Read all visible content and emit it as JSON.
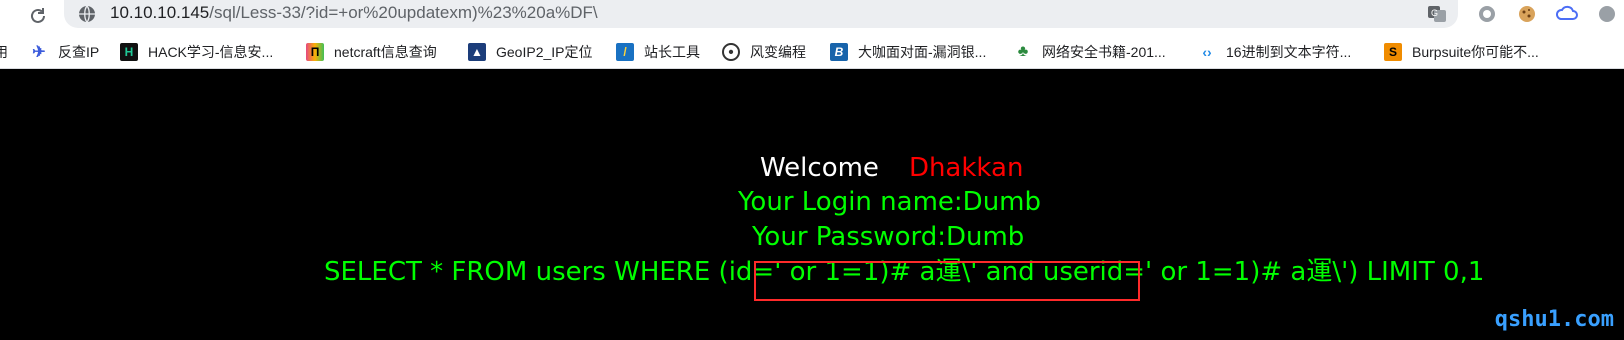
{
  "browser": {
    "url_host": "10.10.10.145",
    "url_rest": "/sql/Less-33/?id=+or%20updatexm)%23%20a%DF\\",
    "extensions": [
      "translate-icon",
      "record-icon",
      "cookie-icon",
      "cloud-icon",
      "puzzle-icon"
    ]
  },
  "bookmarks": [
    {
      "label": "用",
      "icon": "folder-icon",
      "color": "#f4b400"
    },
    {
      "label": "反查IP",
      "icon": "bird-icon",
      "color": "#3b5bdb"
    },
    {
      "label": "HACK学习-信息安...",
      "icon": "hack-icon",
      "color": "#111111"
    },
    {
      "label": "netcraft信息查询",
      "icon": "netcraft-icon",
      "color": "#e64980"
    },
    {
      "label": "GeoIP2_IP定位",
      "icon": "geoip-icon",
      "color": "#1c3d7a"
    },
    {
      "label": "站长工具",
      "icon": "chinaz-icon",
      "color": "#1971c2"
    },
    {
      "label": "风变编程",
      "icon": "panda-icon",
      "color": "#333333"
    },
    {
      "label": "大咖面对面-漏洞银...",
      "icon": "bugbank-icon",
      "color": "#1864ab"
    },
    {
      "label": "网络安全书籍-201...",
      "icon": "plant-icon",
      "color": "#2b8a3e"
    },
    {
      "label": "16进制到文本字符...",
      "icon": "code-icon",
      "color": "#228be6"
    },
    {
      "label": "Burpsuite你可能不...",
      "icon": "burp-icon",
      "color": "#f08c00"
    }
  ],
  "page": {
    "welcome": "Welcome",
    "user": "Dhakkan",
    "login_name": "Your Login name:Dumb",
    "password": "Your Password:Dumb",
    "query_prefix": "SELECT * FROM users WHERE (id=",
    "query_highlight": "' or 1=1)# a運\\' and userid='",
    "query_suffix": " or 1=1)# a運\\') LIMIT 0,1",
    "watermark": "qshu1.com"
  }
}
